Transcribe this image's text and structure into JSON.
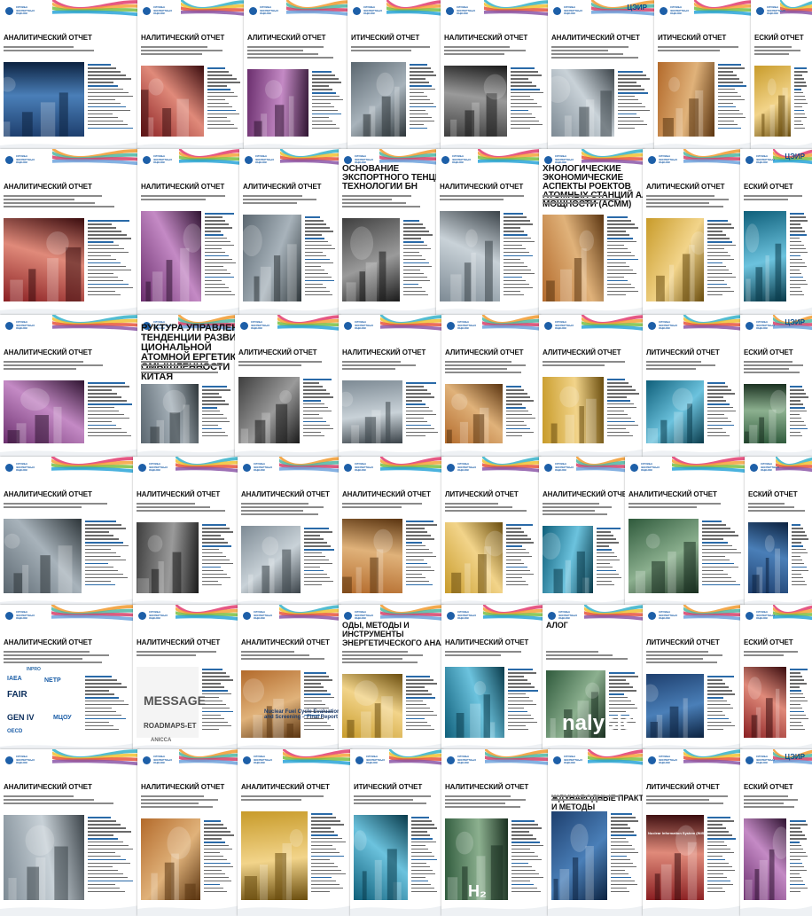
{
  "page": {
    "title": "Аналитические отчеты — коллаж обложек"
  },
  "labels": {
    "report": "АНАЛИТИЧЕСКИЙ ОТЧЕТ",
    "report_crop1": "НАЛИТИЧЕСКИЙ ОТЧЕТ",
    "report_crop2": "АЛИТИЧЕСКИЙ ОТЧЕТ",
    "report_crop3": "ЛИТИЧЕСКИЙ ОТЧЕТ",
    "report_crop4": "ИТИЧЕСКИЙ ОТЧЕТ",
    "report_crop5": "ЕСКИЙ ОТЧЕТ",
    "cifr": "ЦЭИР",
    "logo": "СЛУЖБА ЭКСПЕРТНЫХ ОЦЕНОК"
  },
  "special_titles": {
    "bn": "ОСНОВАНИЕ ЭКСПОРТНОГО ТЕНЦИАЛА ТЕХНОЛОГИИ БН",
    "asmm": "ХНОЛОГИЧЕСКИЕ ЭКОНОМИЧЕСКИЕ АСПЕКТЫ РОЕКТОВ АТОМНЫХ СТАНЦИЙ АЛОЙ МОЩНОСТИ (АСММ)",
    "china": "РУКТУРА УПРАВЛЕНИЯ ТЕНДЕНЦИИ РАЗВИТИЯ ЦИОНАЛЬНОЙ АТОМНОЙ ЕРГЕТИКИ И ОМЫШЛЕННОСТИ КИТАЯ",
    "methods": "ОДЫ, МЕТОДЫ И ИНСТРУМЕНТЫ ЭНЕРГЕТИЧЕСКОГО АНАЛИЗА",
    "practices": "ЖДУНАРОДНЫЕ ПРАКТИКИ И МЕТОДЫ",
    "alog": "АЛОГ"
  },
  "image_words": {
    "message": "MESSAGE",
    "roadmaps": "ROADMAPS-ET",
    "aniccа": "ANICCA",
    "analysis": "nalysis",
    "nfc": "Nuclear Fuel Cycle Evaluation and Screening – Final Report",
    "h2": "H₂",
    "iaea": "IAEA",
    "fair": "FAIR",
    "netp": "NETP",
    "iaea_netp": "INPRO",
    "genIV": "GEN IV",
    "mgu": "МЦОУ",
    "oecd": "OECD",
    "nuclear_info": "Nuclear Information System (INIS)"
  }
}
